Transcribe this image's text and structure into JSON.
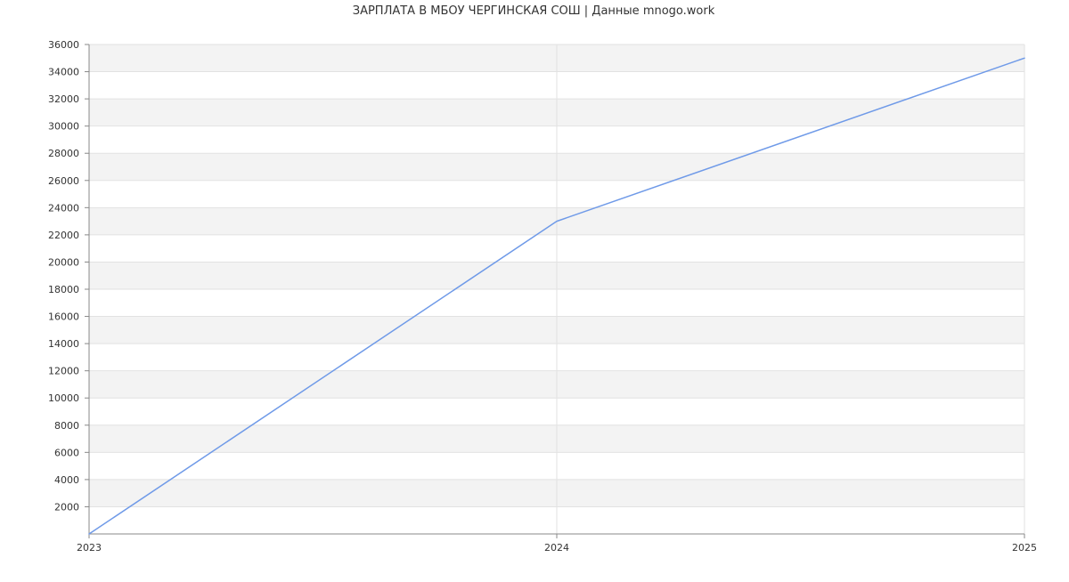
{
  "chart_data": {
    "type": "line",
    "title": "ЗАРПЛАТА В МБОУ ЧЕРГИНСКАЯ СОШ | Данные mnogo.work",
    "xlabel": "",
    "ylabel": "",
    "x": [
      "2023",
      "2024",
      "2025"
    ],
    "series": [
      {
        "values": [
          0,
          23000,
          35000
        ]
      }
    ],
    "ylim": [
      0,
      36000
    ],
    "yticks": [
      2000,
      4000,
      6000,
      8000,
      10000,
      12000,
      14000,
      16000,
      18000,
      20000,
      22000,
      24000,
      26000,
      28000,
      30000,
      32000,
      34000,
      36000
    ],
    "grid": true,
    "legend": "none"
  },
  "colors": {
    "line": "#6f9ae8",
    "band": "#f3f3f3",
    "grid": "#e2e2e2",
    "axis": "#888888"
  }
}
